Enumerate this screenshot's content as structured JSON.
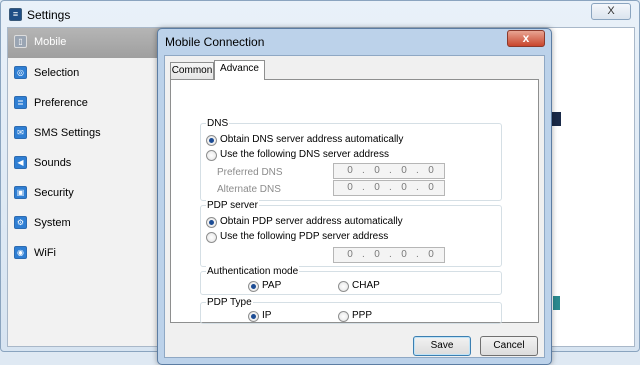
{
  "settings": {
    "title": "Settings",
    "close_label": "X",
    "sidebar": [
      {
        "label": "Mobile",
        "icon": "mobile-icon",
        "selected": true
      },
      {
        "label": "Selection",
        "icon": "selection-icon",
        "selected": false
      },
      {
        "label": "Preference",
        "icon": "preference-icon",
        "selected": false
      },
      {
        "label": "SMS Settings",
        "icon": "sms-icon",
        "selected": false
      },
      {
        "label": "Sounds",
        "icon": "sound-icon",
        "selected": false
      },
      {
        "label": "Security",
        "icon": "security-icon",
        "selected": false
      },
      {
        "label": "System",
        "icon": "system-icon",
        "selected": false
      },
      {
        "label": "WiFi",
        "icon": "wifi-icon",
        "selected": false
      }
    ]
  },
  "dialog": {
    "title": "Mobile Connection",
    "close_label": "x",
    "tabs": [
      {
        "label": "Common",
        "active": false
      },
      {
        "label": "Advance",
        "active": true
      }
    ],
    "dns": {
      "legend": "DNS",
      "auto_label": "Obtain DNS server address automatically",
      "manual_label": "Use the following DNS server address",
      "selected": "auto",
      "preferred_label": "Preferred DNS",
      "alternate_label": "Alternate DNS",
      "preferred_value": [
        "0",
        "0",
        "0",
        "0"
      ],
      "alternate_value": [
        "0",
        "0",
        "0",
        "0"
      ]
    },
    "pdp_server": {
      "legend": "PDP server",
      "auto_label": "Obtain PDP server address automatically",
      "manual_label": "Use the following PDP server address",
      "selected": "auto",
      "address_value": [
        "0",
        "0",
        "0",
        "0"
      ]
    },
    "auth": {
      "legend": "Authentication mode",
      "options": [
        "PAP",
        "CHAP"
      ],
      "selected": "PAP"
    },
    "pdp_type": {
      "legend": "PDP Type",
      "options": [
        "IP",
        "PPP"
      ],
      "selected": "IP"
    },
    "save_label": "Save",
    "cancel_label": "Cancel"
  }
}
